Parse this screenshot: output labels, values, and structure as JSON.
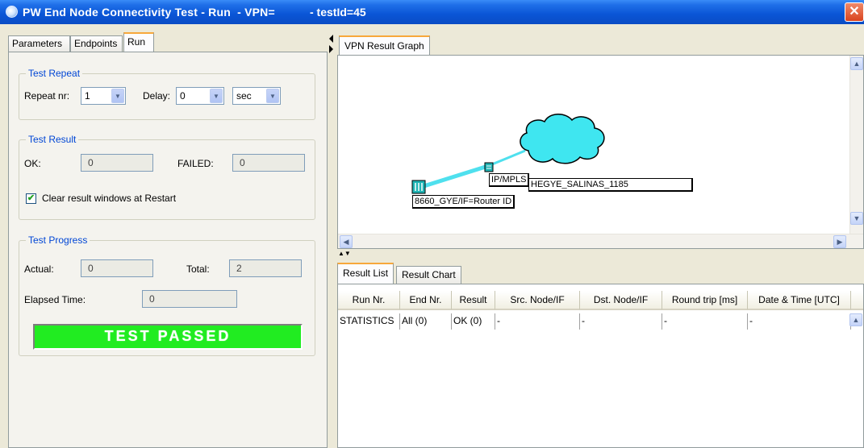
{
  "window": {
    "title": "PW End Node Connectivity Test - Run  - VPN=",
    "test_id": "- testId=45",
    "close_glyph": "✕"
  },
  "left": {
    "tabs": [
      "Parameters",
      "Endpoints",
      "Run"
    ],
    "active_tab": "Run",
    "test_repeat": {
      "title": "Test Repeat",
      "repeat_label": "Repeat nr:",
      "repeat_value": "1",
      "delay_label": "Delay:",
      "delay_value": "0",
      "unit_value": "sec"
    },
    "test_result": {
      "title": "Test Result",
      "ok_label": "OK:",
      "ok_value": "0",
      "failed_label": "FAILED:",
      "failed_value": "0",
      "clear_label": "Clear result windows at Restart",
      "clear_checked": true
    },
    "test_progress": {
      "title": "Test Progress",
      "actual_label": "Actual:",
      "actual_value": "0",
      "total_label": "Total:",
      "total_value": "2",
      "elapsed_label": "Elapsed Time:",
      "elapsed_value": "0",
      "status": "TEST PASSED",
      "status_color": "#21ec21"
    }
  },
  "graph": {
    "tab": "VPN Result Graph",
    "router_label": "8660_GYE/IF=Router ID",
    "mpls_label": "IP/MPLS",
    "cloud_label": "HEGYE_SALINAS_1185",
    "link_color": "#4fe0ee",
    "cloud_color": "#3fe6f0"
  },
  "results": {
    "tabs": [
      "Result List",
      "Result Chart"
    ],
    "active_tab": "Result List",
    "columns": [
      "Run Nr.",
      "End Nr.",
      "Result",
      "Src. Node/IF",
      "Dst. Node/IF",
      "Round trip [ms]",
      "Date & Time [UTC]"
    ],
    "rows": [
      [
        "STATISTICS",
        "All (0)",
        "OK (0)",
        "-",
        "-",
        "-",
        "-"
      ]
    ]
  }
}
